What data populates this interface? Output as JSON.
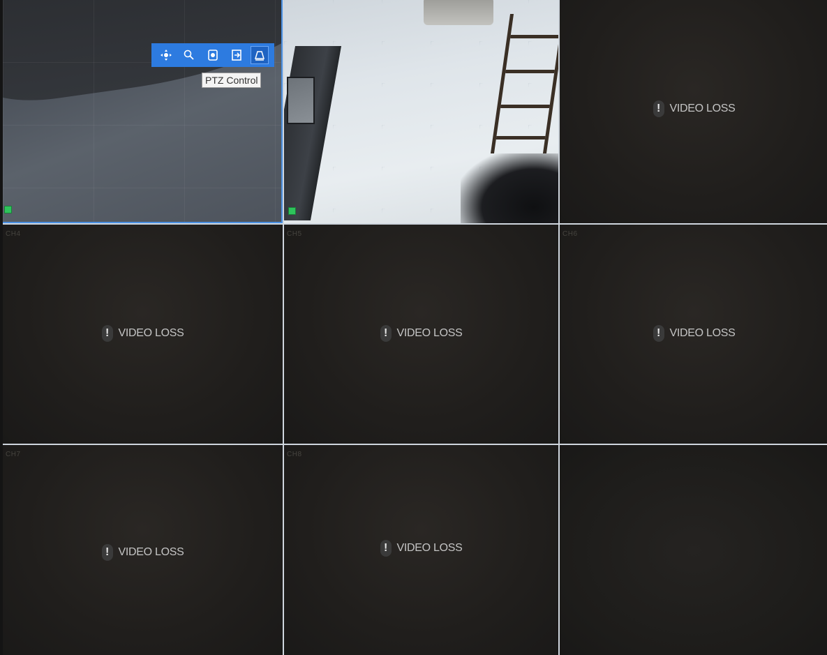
{
  "tooltip": "PTZ Control",
  "ptz_toolbar": {
    "buttons": [
      {
        "name": "ptz-joystick-icon",
        "glyph": "✥",
        "active": false
      },
      {
        "name": "zoom-icon",
        "glyph": "⚲",
        "active": false
      },
      {
        "name": "color-icon",
        "glyph": "◙",
        "active": false
      },
      {
        "name": "exit-icon",
        "glyph": "⇥",
        "active": false
      },
      {
        "name": "ptz-control-icon",
        "glyph": "⌂",
        "active": true
      }
    ]
  },
  "channels": [
    {
      "id": "ch1",
      "label": "",
      "status": "live"
    },
    {
      "id": "ch2",
      "label": "",
      "status": "live"
    },
    {
      "id": "ch3",
      "label": "",
      "status": "loss",
      "message": "VIDEO LOSS"
    },
    {
      "id": "ch4",
      "label": "CH4",
      "status": "loss",
      "message": "VIDEO LOSS"
    },
    {
      "id": "ch5",
      "label": "CH5",
      "status": "loss",
      "message": "VIDEO LOSS"
    },
    {
      "id": "ch6",
      "label": "CH6",
      "status": "loss",
      "message": "VIDEO LOSS"
    },
    {
      "id": "ch7",
      "label": "CH7",
      "status": "loss",
      "message": "VIDEO LOSS"
    },
    {
      "id": "ch8",
      "label": "CH8",
      "status": "loss",
      "message": "VIDEO LOSS"
    },
    {
      "id": "ch9",
      "label": "",
      "status": "empty"
    }
  ],
  "colors": {
    "selection": "#4a90e2",
    "toolbar": "#2d7be0",
    "grid_line": "#cfd6de",
    "record_indicator": "#2ec35b"
  }
}
